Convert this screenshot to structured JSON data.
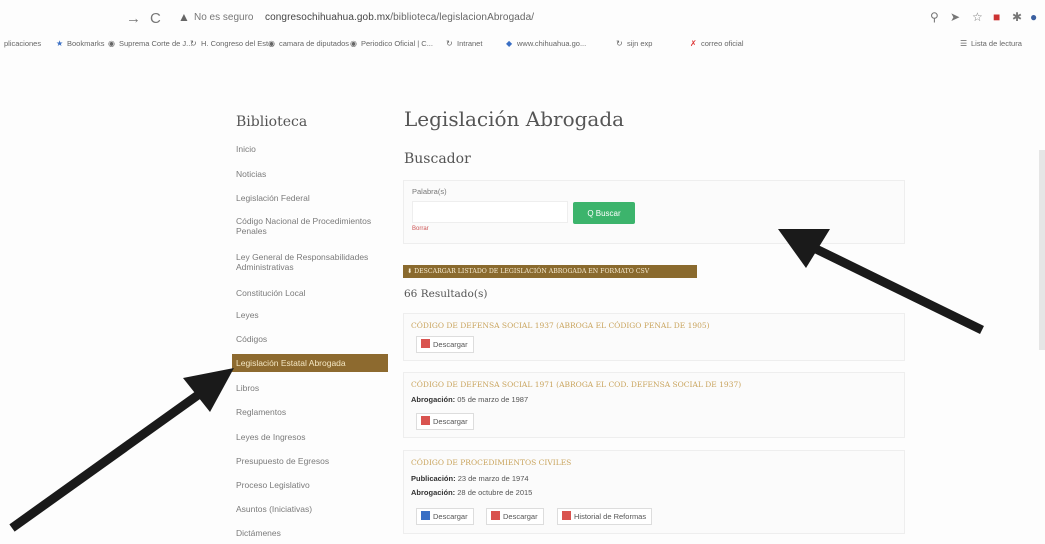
{
  "browser": {
    "security_label": "No es seguro",
    "url_host": "congresochihuahua.gob.mx",
    "url_path": "/biblioteca/legislacionAbrogada/",
    "bookmarks": [
      {
        "label": "plicaciones",
        "icon": "apps-icon"
      },
      {
        "label": "Bookmarks",
        "icon": "star-icon"
      },
      {
        "label": "Suprema Corte de J...",
        "icon": "globe-icon"
      },
      {
        "label": "H. Congreso del Est...",
        "icon": "link-icon"
      },
      {
        "label": "camara de diputados",
        "icon": "globe-icon"
      },
      {
        "label": "Periodico Oficial | C...",
        "icon": "globe-icon"
      },
      {
        "label": "Intranet",
        "icon": "link-icon"
      },
      {
        "label": "www.chihuahua.go...",
        "icon": "shield-icon"
      },
      {
        "label": "sijn exp",
        "icon": "link-icon"
      },
      {
        "label": "correo oficial",
        "icon": "x-icon"
      },
      {
        "label": "Lista de lectura",
        "icon": "list-icon"
      }
    ]
  },
  "sidebar": {
    "title": "Biblioteca",
    "items": [
      {
        "label": "Inicio"
      },
      {
        "label": "Noticias"
      },
      {
        "label": "Legislación Federal"
      },
      {
        "label": "Código Nacional de Procedimientos Penales"
      },
      {
        "label": "Ley General de Responsabilidades Administrativas"
      },
      {
        "label": "Constitución Local"
      },
      {
        "label": "Leyes"
      },
      {
        "label": "Códigos"
      },
      {
        "label": "Legislación Estatal Abrogada"
      },
      {
        "label": "Libros"
      },
      {
        "label": "Reglamentos"
      },
      {
        "label": "Leyes de Ingresos"
      },
      {
        "label": "Presupuesto de Egresos"
      },
      {
        "label": "Proceso Legislativo"
      },
      {
        "label": "Asuntos (Iniciativas)"
      },
      {
        "label": "Dictámenes"
      }
    ],
    "active_index": 8
  },
  "main": {
    "title": "Legislación Abrogada",
    "search": {
      "heading": "Buscador",
      "label": "Palabra(s)",
      "value": "",
      "button": "Q Buscar",
      "clear": "Borrar"
    },
    "csv_button": "⬇ DESCARGAR LISTADO DE LEGISLACIÓN ABROGADA EN FORMATO CSV",
    "results_count": "66 Resultado(s)",
    "results": [
      {
        "title": "CÓDIGO DE DEFENSA SOCIAL 1937 (ABROGA EL CÓDIGO PENAL DE 1905)",
        "download": "Descargar"
      },
      {
        "title": "CÓDIGO DE DEFENSA SOCIAL 1971 (ABROGA EL COD. DEFENSA SOCIAL DE 1937)",
        "abrogacion_label": "Abrogación:",
        "abrogacion": "05 de marzo de 1987",
        "download": "Descargar"
      },
      {
        "title": "CÓDIGO DE PROCEDIMIENTOS CIVILES",
        "publicacion_label": "Publicación:",
        "publicacion": "23 de marzo de 1974",
        "abrogacion_label": "Abrogación:",
        "abrogacion": "28 de octubre de 2015",
        "download_word": "Descargar",
        "download": "Descargar",
        "history": "Historial de Reformas"
      }
    ]
  },
  "colors": {
    "accent": "#8d6a2f",
    "search_button": "#3cb46c",
    "result_title": "#c9a45d",
    "pdf": "#d9534f"
  }
}
